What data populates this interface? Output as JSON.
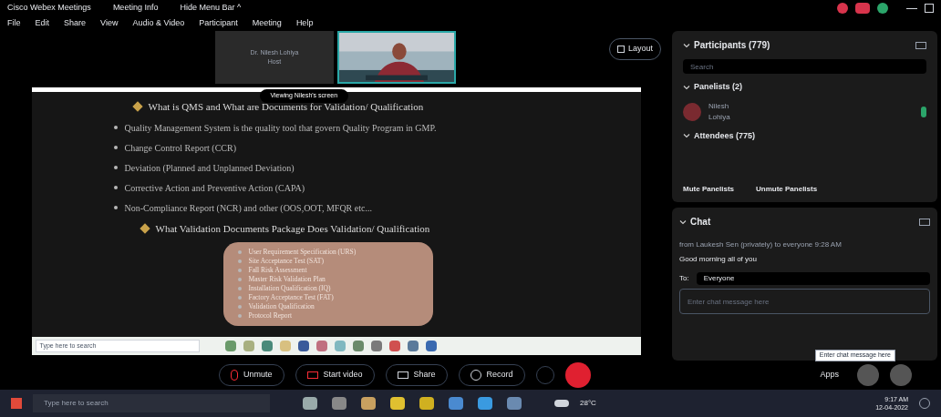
{
  "title_bar": {
    "app": "Cisco Webex Meetings",
    "meeting_info": "Meeting Info",
    "hide_menu": "Hide Menu Bar ^"
  },
  "menu": [
    "File",
    "Edit",
    "Share",
    "View",
    "Audio & Video",
    "Participant",
    "Meeting",
    "Help"
  ],
  "videos": [
    {
      "kind": "name",
      "name": "Dr. Nilesh Lohiya",
      "sub": "Host"
    },
    {
      "kind": "picture"
    }
  ],
  "layout_button": "Layout",
  "shared_screen": {
    "banner": "Viewing Nilesh's screen",
    "heading": "What is QMS and What are Documents for Validation/ Qualification",
    "bullets": [
      "Quality Management System is the quality tool that govern Quality Program in GMP.",
      "Change Control Report (CCR)",
      "Deviation (Planned and Unplanned Deviation)",
      "Corrective Action and Preventive Action (CAPA)",
      "Non-Compliance Report (NCR) and other (OOS,OOT, MFQR etc..."
    ],
    "subheading": "What Validation Documents Package Does Validation/ Qualification",
    "box_items": [
      "User Requirement Specification (URS)",
      "Site Acceptance Test (SAT)",
      "Fall Risk Assessment",
      "Master Risk Validation Plan",
      "Installation Qualification (IQ)",
      "Factory Acceptance Test (FAT)",
      "Validation Qualification",
      "Protocol Report"
    ],
    "taskbar_search": "Type here to search"
  },
  "participants": {
    "title": "Participants (779)",
    "search_placeholder": "Search",
    "panelists": "Panelists (2)",
    "panelist": {
      "name": "Nilesh",
      "sub": "Lohiya"
    },
    "attendees": "Attendees (775)",
    "mute": "Mute Panelists",
    "unmute": "Unmute Panelists"
  },
  "chat": {
    "title": "Chat",
    "from": "from Laukesh Sen (privately) to everyone   9:28 AM",
    "message": "Good morning all of you",
    "to_label": "To:",
    "to_value": "Everyone",
    "placeholder": "Enter chat message here",
    "tooltip": "Enter chat message here"
  },
  "controls": [
    {
      "kind": "mic",
      "label": "Unmute"
    },
    {
      "kind": "video",
      "label": "Start video"
    },
    {
      "kind": "share",
      "label": "Share"
    },
    {
      "kind": "record",
      "label": "Record"
    }
  ],
  "apps": "Apps",
  "taskbar": {
    "search": "Type here to search",
    "weather": "28°C",
    "time": "9:17 AM",
    "date": "12-04-2022"
  }
}
